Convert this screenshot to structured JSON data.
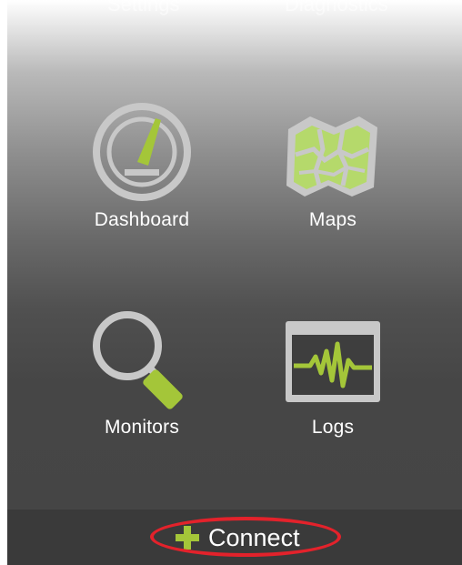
{
  "top_labels": {
    "settings": "Settings",
    "diagnostics": "Diagnostics"
  },
  "tiles": {
    "dashboard": {
      "label": "Dashboard",
      "icon": "speedometer-icon"
    },
    "maps": {
      "label": "Maps",
      "icon": "map-icon"
    },
    "monitors": {
      "label": "Monitors",
      "icon": "magnifier-icon"
    },
    "logs": {
      "label": "Logs",
      "icon": "waveform-log-icon"
    }
  },
  "bottom_bar": {
    "connect_label": "Connect",
    "connect_icon": "plus-icon"
  },
  "colors": {
    "accent_green": "#a4c639",
    "icon_gray": "#c8c8c8",
    "highlight_red": "#e3222b",
    "bottom_bar": "#3a3a3a"
  }
}
